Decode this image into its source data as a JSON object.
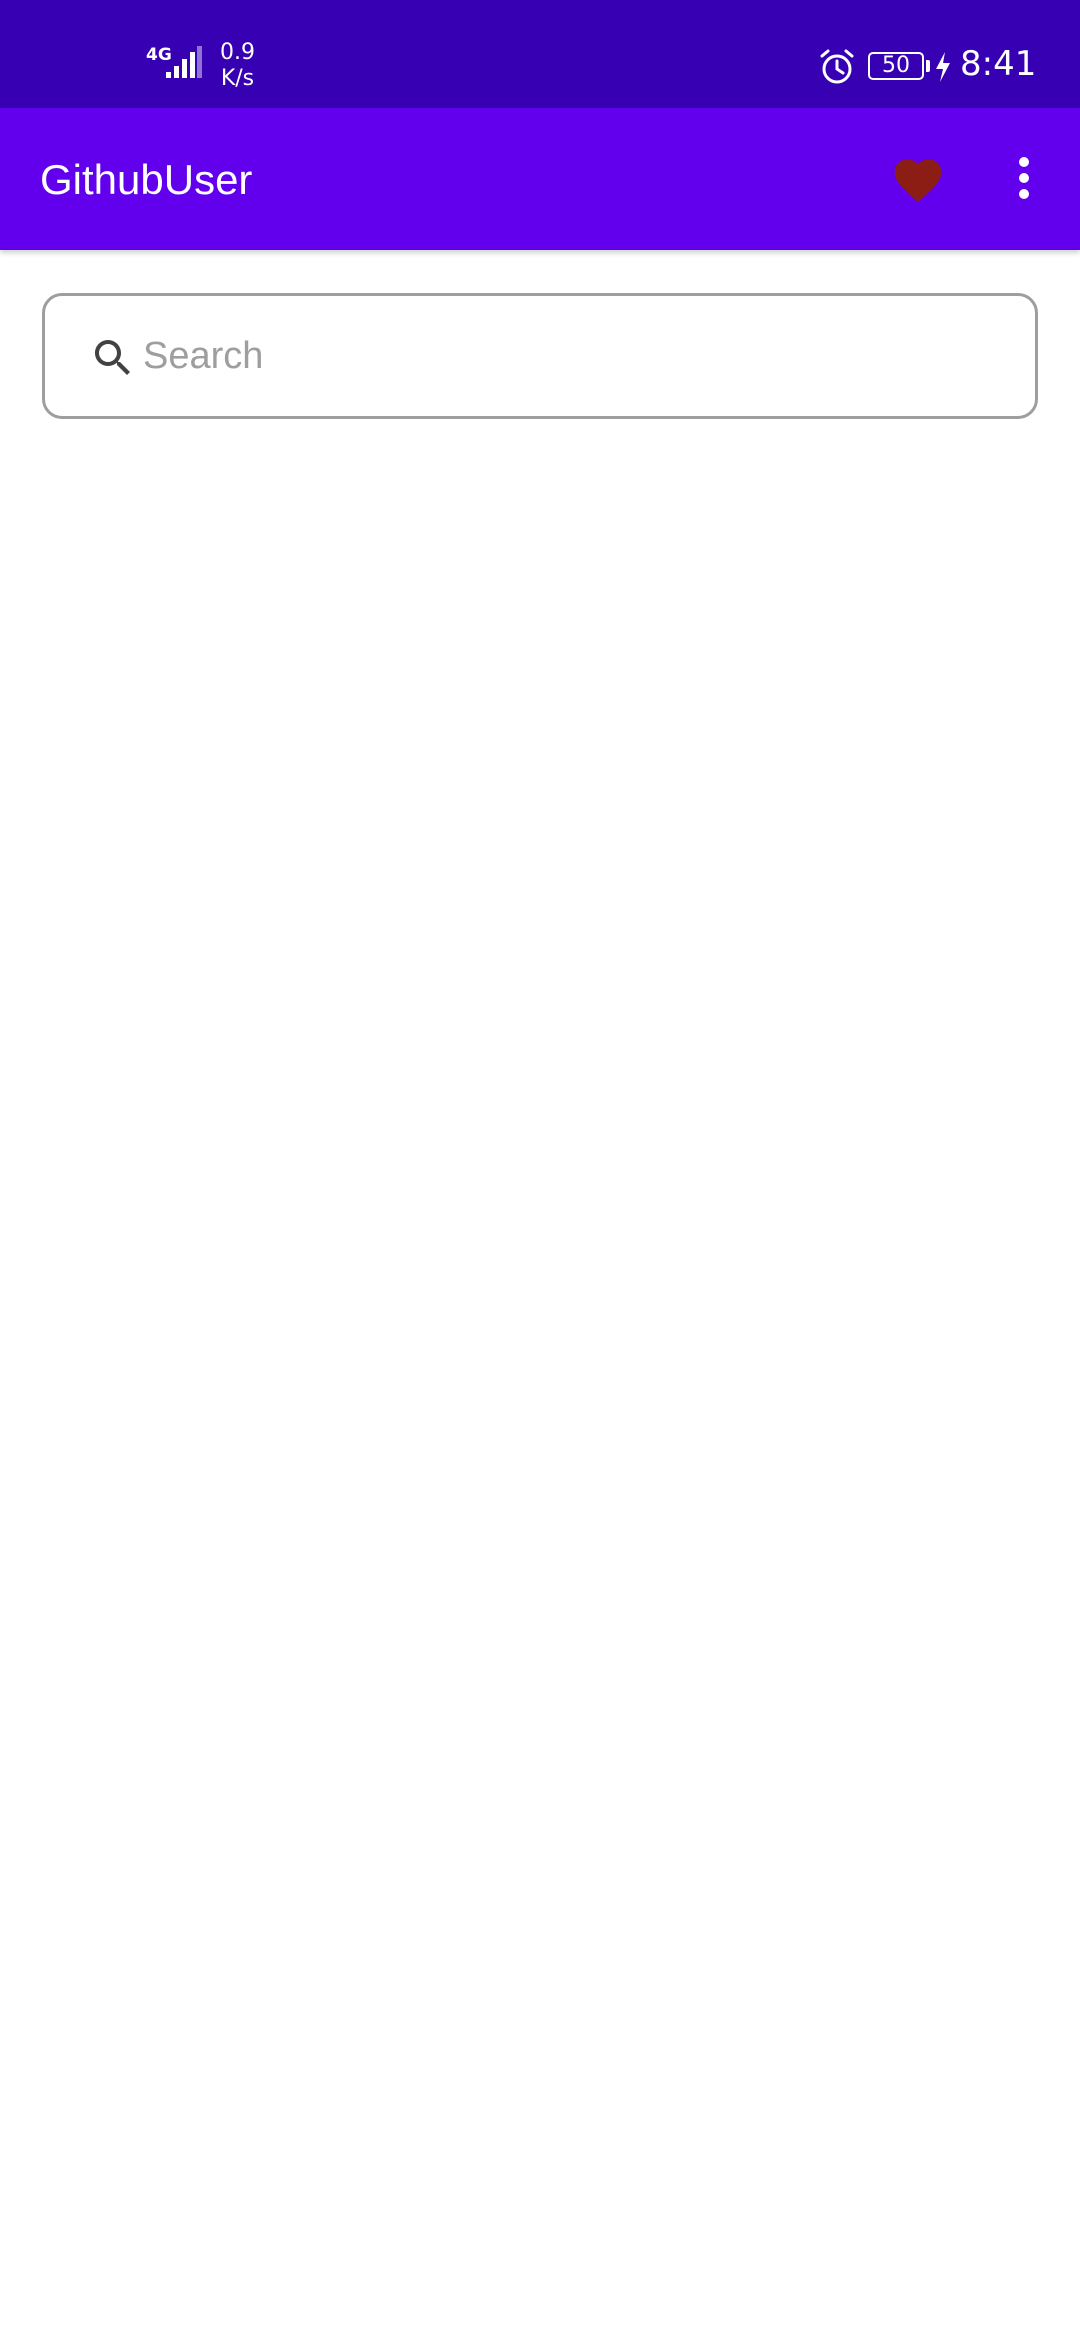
{
  "status_bar": {
    "network_type": "4G",
    "speed_value": "0.9",
    "speed_unit": "K/s",
    "battery_level": "50",
    "time": "8:41",
    "icons": [
      "signal-icon",
      "alarm-icon",
      "battery-icon",
      "charging-bolt-icon"
    ]
  },
  "app_bar": {
    "title": "GithubUser",
    "favorite_icon": "heart-icon",
    "favorite_color": "#8b1d14",
    "menu_icon": "more-vert-icon",
    "background_color": "#6200ee"
  },
  "search": {
    "placeholder": "Search",
    "value": "",
    "icon": "search-icon"
  },
  "colors": {
    "status_bar": "#3700b3",
    "primary": "#6200ee",
    "favorite": "#8b1d14"
  }
}
